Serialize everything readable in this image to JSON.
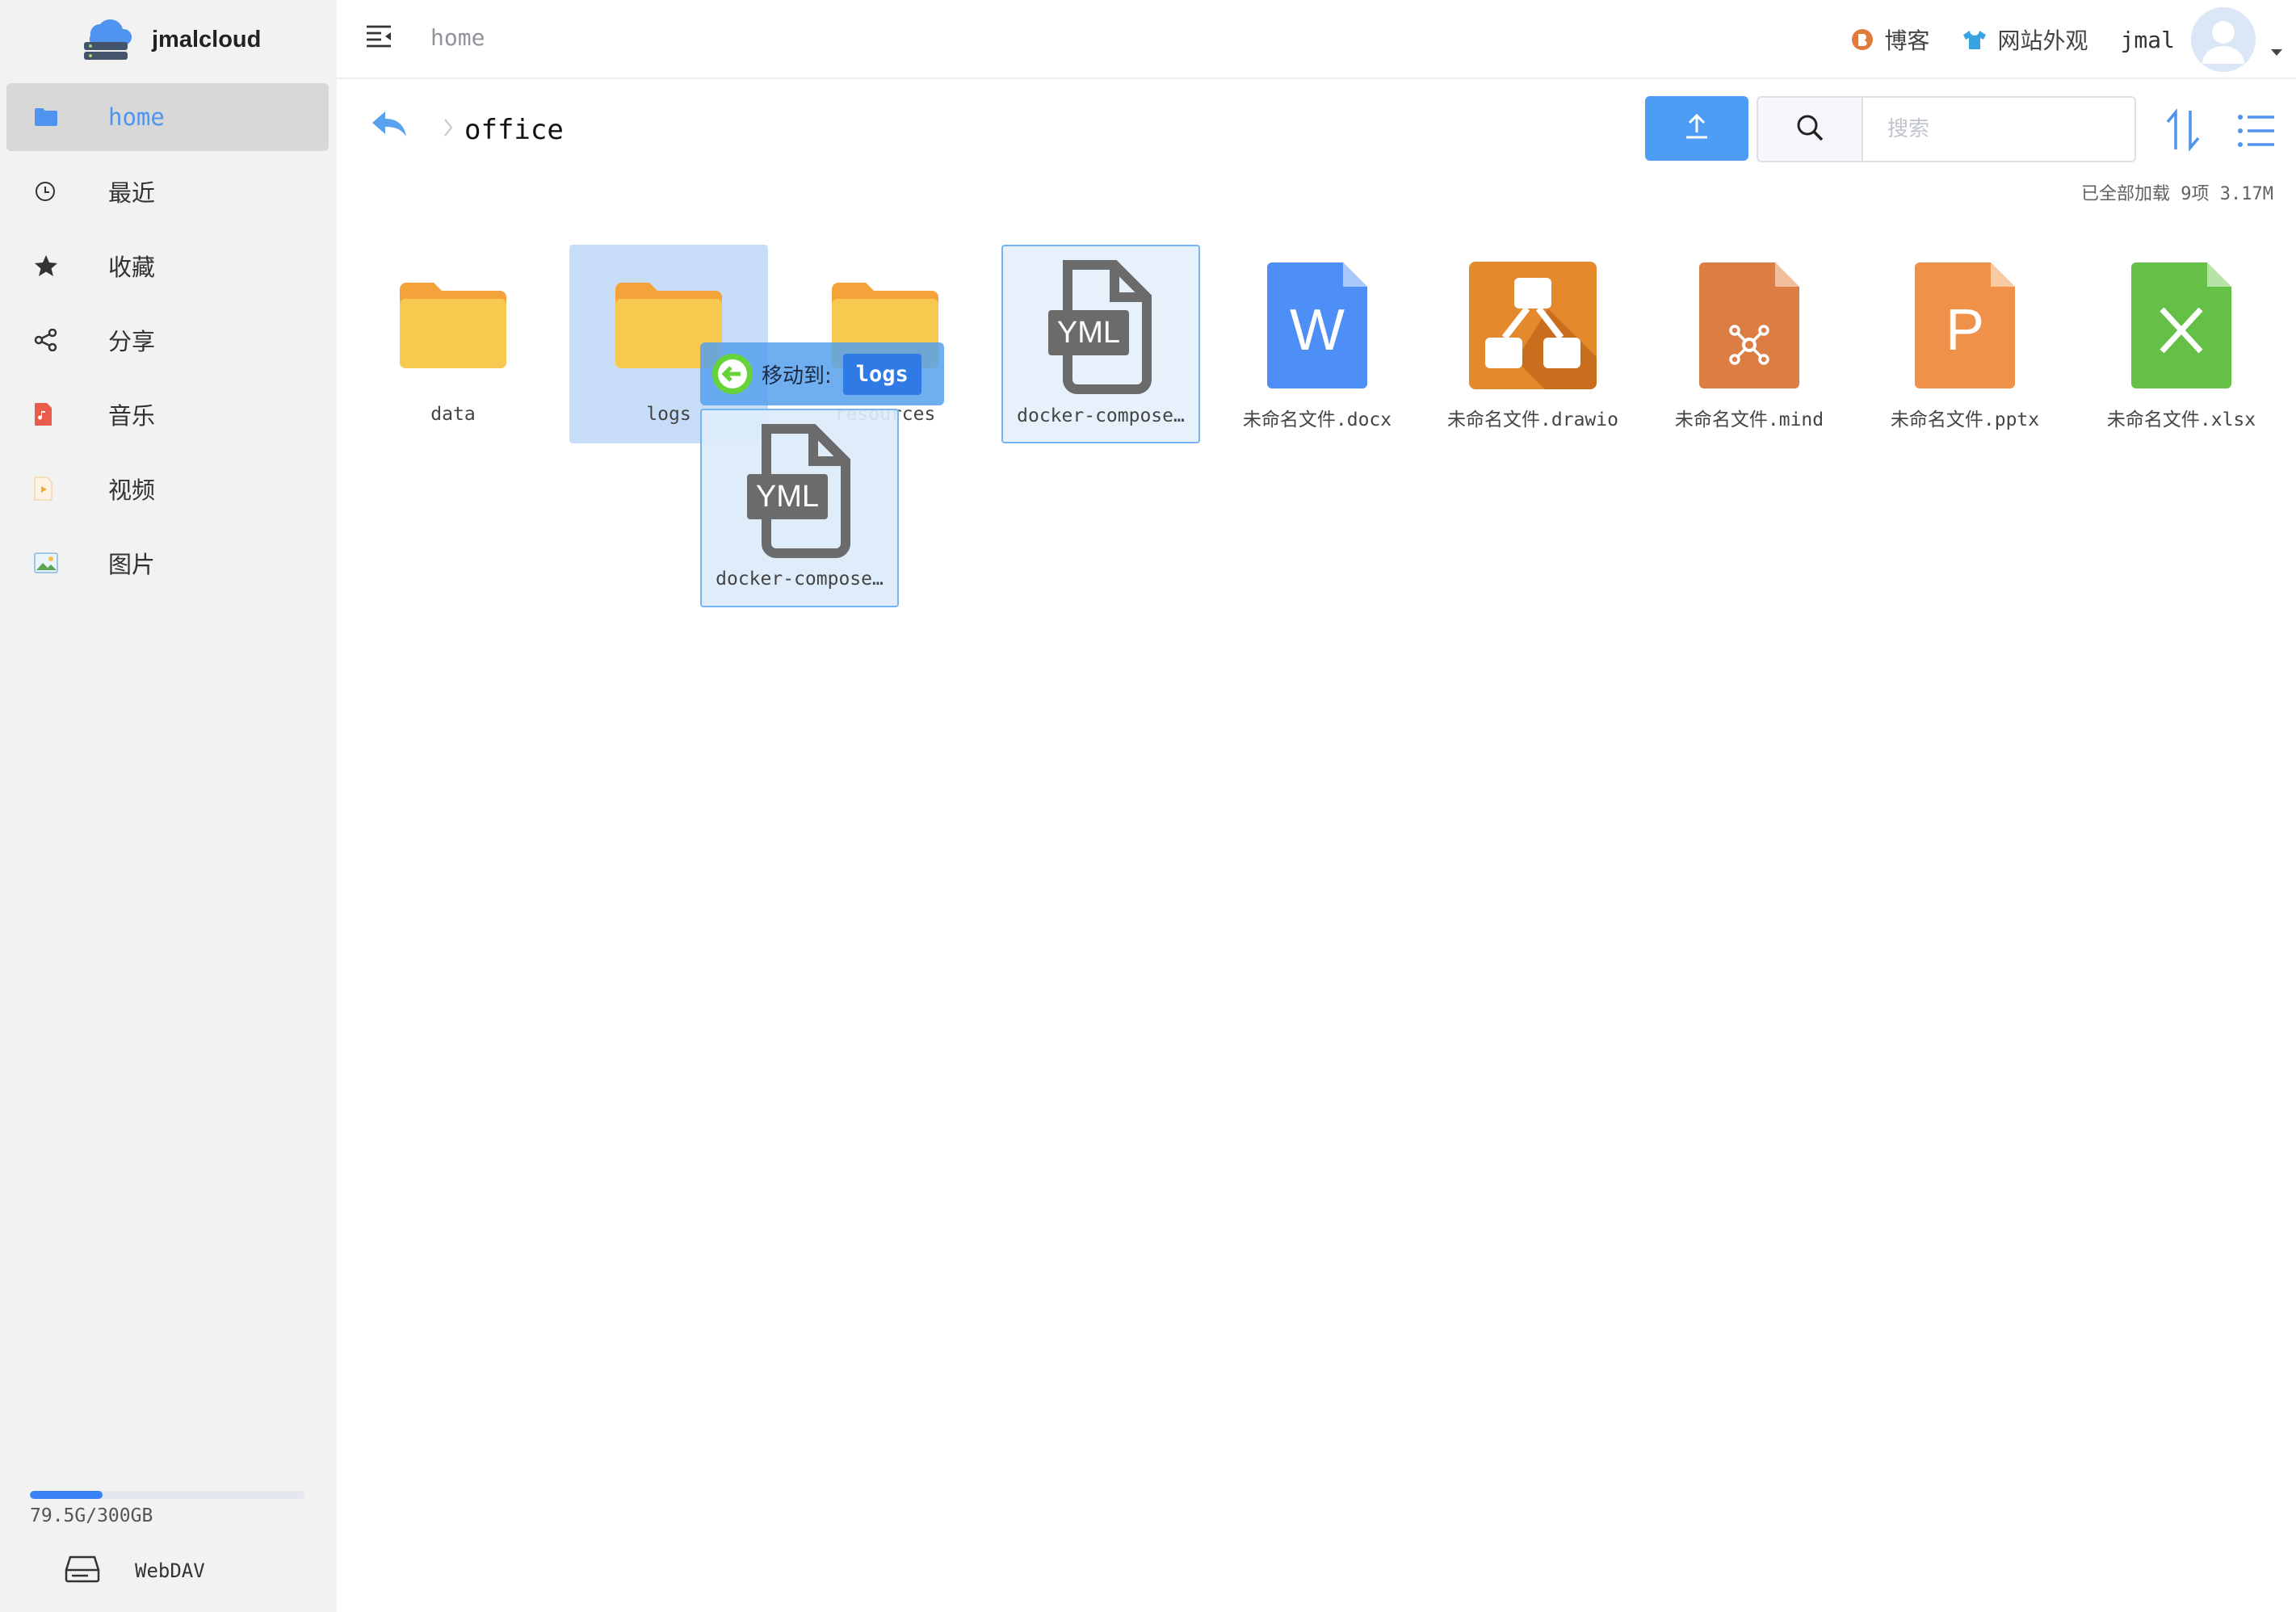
{
  "app": {
    "name": "jmalcloud"
  },
  "sidebar": {
    "items": [
      {
        "label": "home",
        "icon": "folder-icon",
        "active": true
      },
      {
        "label": "最近",
        "icon": "clock-icon"
      },
      {
        "label": "收藏",
        "icon": "star-icon"
      },
      {
        "label": "分享",
        "icon": "share-icon"
      },
      {
        "label": "音乐",
        "icon": "music-icon"
      },
      {
        "label": "视频",
        "icon": "video-icon"
      },
      {
        "label": "图片",
        "icon": "image-icon"
      }
    ],
    "storage": {
      "text": "79.5G/300GB",
      "used_fraction": 0.265
    },
    "webdav_label": "WebDAV"
  },
  "header": {
    "breadcrumb": "home",
    "links": [
      {
        "label": "博客",
        "icon": "blog-icon"
      },
      {
        "label": "网站外观",
        "icon": "shirt-icon"
      }
    ],
    "user_name": "jmal"
  },
  "toolbar": {
    "current_folder": "office",
    "search_placeholder": "搜索",
    "summary": "已全部加载 9项 3.17M"
  },
  "files": [
    {
      "name": "data",
      "type": "folder"
    },
    {
      "name": "logs",
      "type": "folder",
      "state": "drop-target"
    },
    {
      "name": "resources",
      "type": "folder"
    },
    {
      "name": "docker-compose…",
      "type": "yml",
      "state": "selected"
    },
    {
      "name": "未命名文件.docx",
      "type": "docx",
      "color": "#4e8ef7"
    },
    {
      "name": "未命名文件.drawio",
      "type": "drawio",
      "color": "#e5892d"
    },
    {
      "name": "未命名文件.mind",
      "type": "mind",
      "color": "#dc7d44"
    },
    {
      "name": "未命名文件.pptx",
      "type": "pptx",
      "color": "#f0914a"
    },
    {
      "name": "未命名文件.xlsx",
      "type": "xlsx",
      "color": "#64c047"
    }
  ],
  "drag": {
    "tip_text": "移动到:",
    "target": "logs",
    "ghost_name": "docker-compose…",
    "ghost_badge": "YML"
  },
  "icons": {
    "yml_badge": "YML",
    "docx_letter": "W",
    "pptx_letter": "P"
  }
}
